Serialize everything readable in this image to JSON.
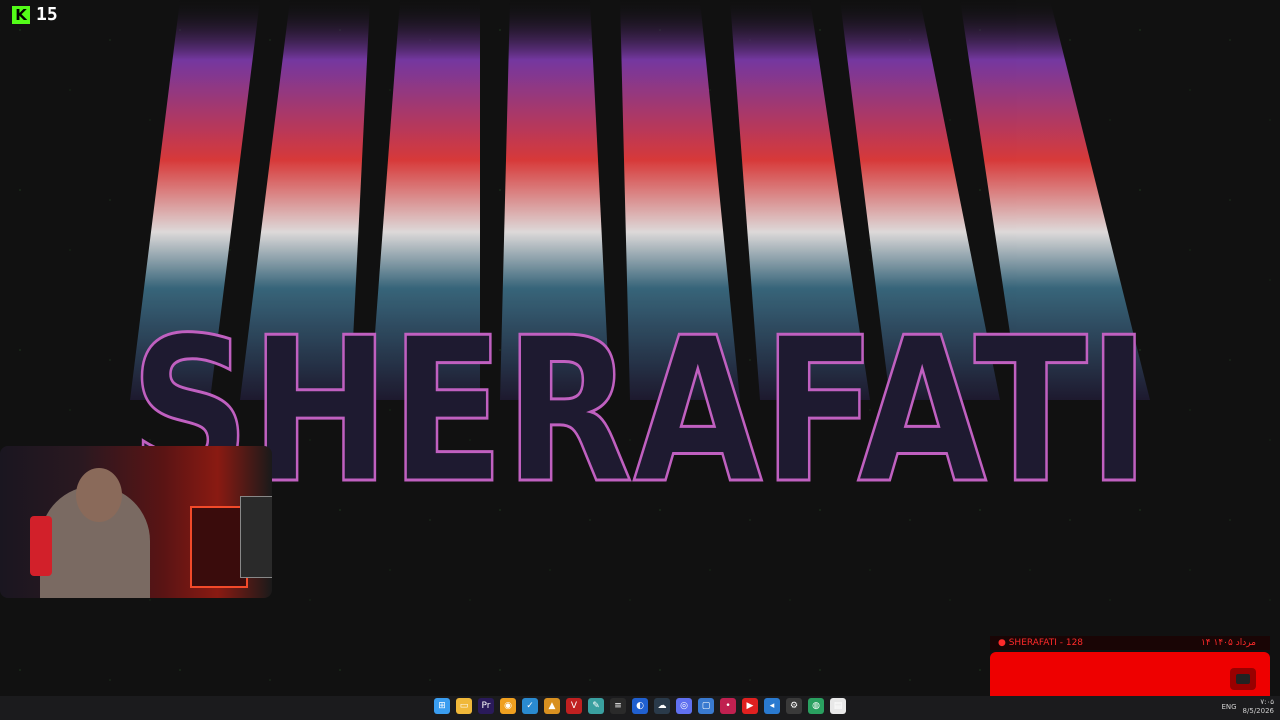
{
  "wallpaper": {
    "title": "SHERAFATI",
    "colors": {
      "text": "#1e1a30",
      "flame1": "#e8e4e4",
      "flame2": "#e23c3c",
      "flame3": "#7a3aa8",
      "bg": "#111111"
    }
  },
  "fps_counter": {
    "logo": "K",
    "value": "15"
  },
  "stream_overlay": {
    "left_text": "● SHERAFATI - 128",
    "right_text": "۱۴ مرداد ۱۴۰۵",
    "colors": {
      "accent": "#ee0000"
    }
  },
  "taskbar": {
    "icons": [
      {
        "name": "start-icon",
        "color": "#3a9df0",
        "glyph": "⊞"
      },
      {
        "name": "file-explorer-icon",
        "color": "#f0b83a",
        "glyph": "▭"
      },
      {
        "name": "premiere-icon",
        "color": "#2a1a5a",
        "glyph": "Pr"
      },
      {
        "name": "chrome-icon",
        "color": "#f0a020",
        "glyph": "◉"
      },
      {
        "name": "app-check-icon",
        "color": "#2a8ad0",
        "glyph": "✓"
      },
      {
        "name": "app-warning-icon",
        "color": "#d89020",
        "glyph": "▲"
      },
      {
        "name": "app-red-icon",
        "color": "#c02020",
        "glyph": "V"
      },
      {
        "name": "app-pen-icon",
        "color": "#3aa0a0",
        "glyph": "✎"
      },
      {
        "name": "app-dash-icon",
        "color": "#2a2a2a",
        "glyph": "≡"
      },
      {
        "name": "app-blue-circle-icon",
        "color": "#2060d0",
        "glyph": "◐"
      },
      {
        "name": "steam-icon",
        "color": "#2a3a4a",
        "glyph": "☁"
      },
      {
        "name": "discord-icon",
        "color": "#6070f0",
        "glyph": "◎"
      },
      {
        "name": "app-window-icon",
        "color": "#3a7ad0",
        "glyph": "▢"
      },
      {
        "name": "app-pink-icon",
        "color": "#c02050",
        "glyph": "•"
      },
      {
        "name": "youtube-icon",
        "color": "#e02020",
        "glyph": "▶"
      },
      {
        "name": "vscode-icon",
        "color": "#2a7ad0",
        "glyph": "◂"
      },
      {
        "name": "app-settings-icon",
        "color": "#3a3a3a",
        "glyph": "⚙"
      },
      {
        "name": "app-green-icon",
        "color": "#2aa060",
        "glyph": "◍"
      },
      {
        "name": "notepad-icon",
        "color": "#e8e8e8",
        "glyph": "▤"
      }
    ],
    "tray": {
      "lang": "ENG",
      "time": "۷:۰۵",
      "date": "8/5/2026"
    }
  }
}
